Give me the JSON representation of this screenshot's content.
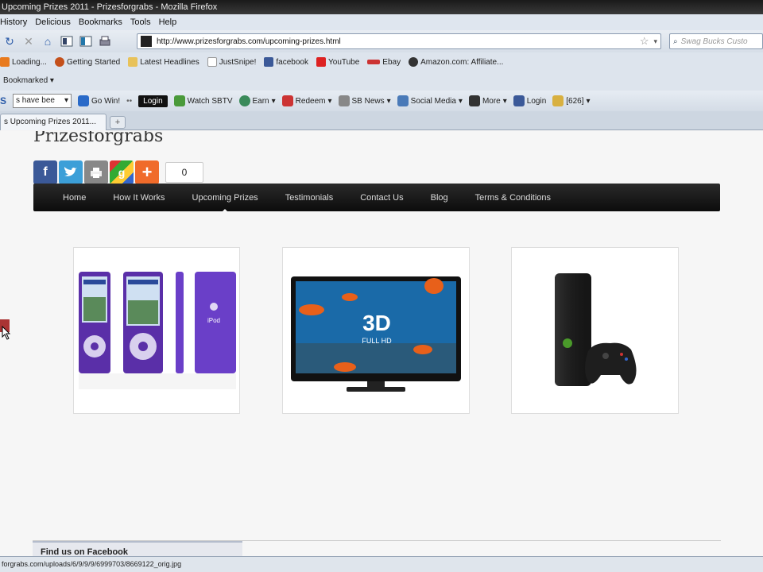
{
  "window": {
    "title": "Upcoming Prizes 2011 - Prizesforgrabs - Mozilla Firefox"
  },
  "menu": {
    "items": [
      "History",
      "Delicious",
      "Bookmarks",
      "Tools",
      "Help"
    ]
  },
  "nav": {
    "url": "http://www.prizesforgrabs.com/upcoming-prizes.html",
    "search_placeholder": "Swag Bucks Custo"
  },
  "bookmarks": {
    "items": [
      "Loading...",
      "Getting Started",
      "Latest Headlines",
      "JustSnipe!",
      "facebook",
      "YouTube",
      "Ebay",
      "Amazon.com: Affiliate..."
    ],
    "row2": "Bookmarked"
  },
  "sbtoolbar": {
    "select_value": "s have bee",
    "go_win": "Go Win!",
    "login": "Login",
    "watch": "Watch SBTV",
    "earn": "Earn",
    "redeem": "Redeem",
    "news": "SB News",
    "social": "Social Media",
    "more": "More",
    "login2": "Login",
    "count": "[626]"
  },
  "tab": {
    "label": "s Upcoming Prizes 2011...",
    "new_tab": "+"
  },
  "page": {
    "logo": "Prizesforgrabs",
    "share_count": "0",
    "menu": [
      "Home",
      "How It Works",
      "Upcoming Prizes",
      "Testimonials",
      "Contact Us",
      "Blog",
      "Terms & Conditions"
    ],
    "tv_text_main": "3D",
    "tv_text_sub": "FULL HD",
    "facebook_box": "Find us on Facebook"
  },
  "status": {
    "text": "forgrabs.com/uploads/6/9/9/9/6999703/8669122_orig.jpg"
  }
}
